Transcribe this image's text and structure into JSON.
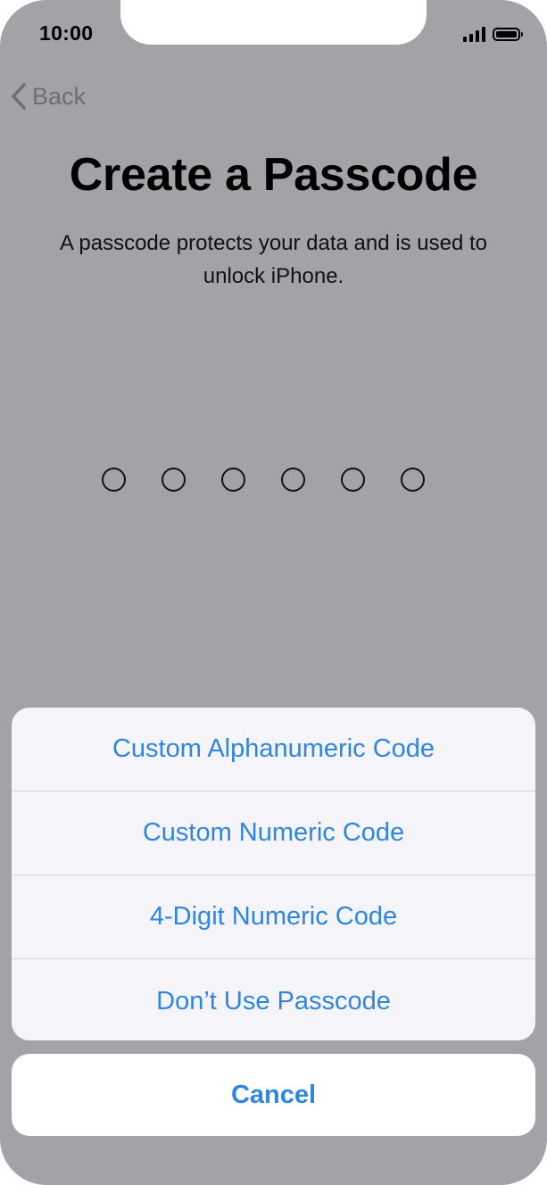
{
  "status_bar": {
    "time": "10:00",
    "signal_icon": "cellular-signal-icon",
    "battery_icon": "battery-icon"
  },
  "nav": {
    "back_label": "Back",
    "back_icon": "chevron-left-icon"
  },
  "page": {
    "title": "Create a Passcode",
    "subtitle": "A passcode protects your data and is used to unlock iPhone."
  },
  "passcode": {
    "length": 6,
    "entered": 0
  },
  "action_sheet": {
    "options": [
      {
        "label": "Custom Alphanumeric Code"
      },
      {
        "label": "Custom Numeric Code"
      },
      {
        "label": "4-Digit Numeric Code"
      },
      {
        "label": "Don’t Use Passcode"
      }
    ],
    "cancel_label": "Cancel"
  },
  "colors": {
    "dimmed_background": "#a3a2a6",
    "accent": "#2f86e0",
    "sheet_background": "#f5f4f8",
    "back_text": "#6e6e72"
  }
}
